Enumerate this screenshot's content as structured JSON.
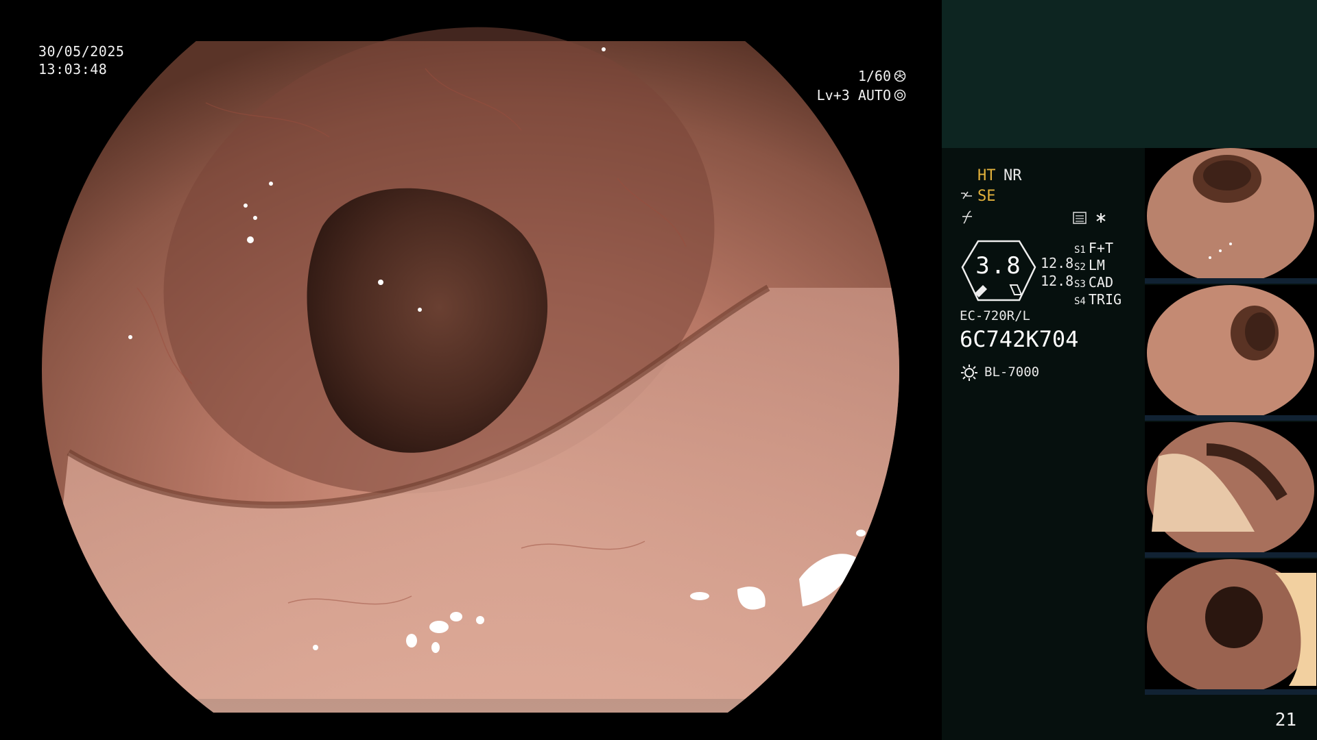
{
  "osd": {
    "date": "30/05/2025",
    "time": "13:03:48",
    "shutter": "1/60",
    "level": "Lv+3 AUTO"
  },
  "panel": {
    "ht": "HT",
    "nr": "NR",
    "se": "SE",
    "scope_value": "3.8",
    "scale_1": "12.8",
    "scale_2": "12.8",
    "modes": [
      {
        "key": "S1",
        "label": "F+T"
      },
      {
        "key": "S2",
        "label": "LM"
      },
      {
        "key": "S3",
        "label": "CAD"
      },
      {
        "key": "S4",
        "label": "TRIG"
      }
    ],
    "scope_model": "EC-720R/L",
    "serial": "6C742K704",
    "light_source": "BL-7000",
    "page_number": "21"
  },
  "colors": {
    "accent_yellow": "#e3b23c",
    "panel_bg": "#06100e",
    "panel_top": "#0d2521"
  },
  "icons": {
    "shutter": "aperture-icon",
    "level": "iris-icon",
    "light": "lightbulb-icon",
    "structure": "structure-enhance-icon",
    "asterisk": "asterisk-icon"
  }
}
